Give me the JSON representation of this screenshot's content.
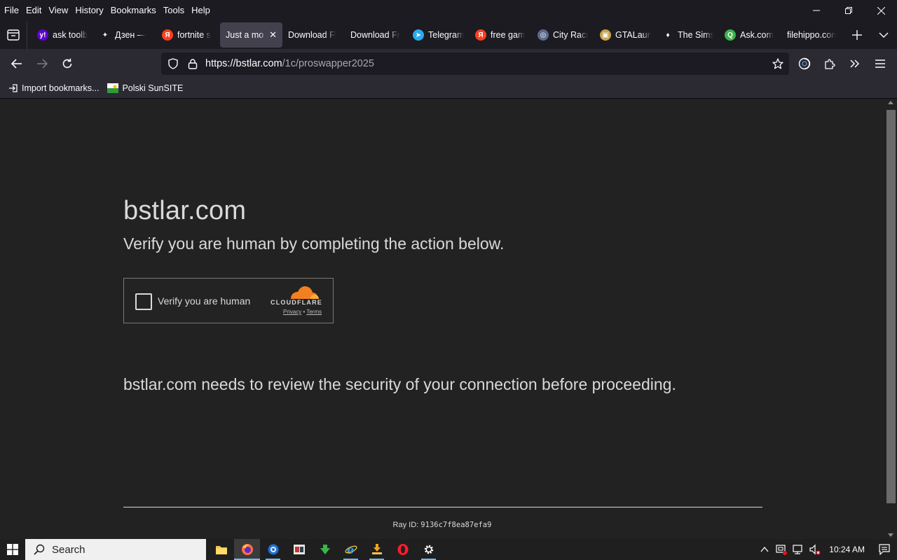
{
  "menu": [
    "File",
    "Edit",
    "View",
    "History",
    "Bookmarks",
    "Tools",
    "Help"
  ],
  "tabs": [
    {
      "label": "ask toolb",
      "icon": "yahoo-icon",
      "color": "#6001d2",
      "glyph": "y!"
    },
    {
      "label": "Дзен —",
      "icon": "dzen-icon",
      "color": "#1c1b22",
      "glyph": "✦"
    },
    {
      "label": "fortnite s",
      "icon": "yandex-icon",
      "color": "#fc3f1d",
      "glyph": "Я"
    },
    {
      "label": "Just a mo",
      "icon": "",
      "color": "",
      "glyph": "",
      "active": true
    },
    {
      "label": "Download Fi",
      "icon": "",
      "color": "",
      "glyph": ""
    },
    {
      "label": "Download Fr",
      "icon": "",
      "color": "",
      "glyph": ""
    },
    {
      "label": "Telegram",
      "icon": "telegram-icon",
      "color": "#2aabee",
      "glyph": "➤"
    },
    {
      "label": "free gam",
      "icon": "yandex-icon",
      "color": "#fc3f1d",
      "glyph": "Я"
    },
    {
      "label": "City Raci",
      "icon": "game-icon",
      "color": "#5a6a8a",
      "glyph": "◎"
    },
    {
      "label": "GTALaun",
      "icon": "gta-icon",
      "color": "#c9a24b",
      "glyph": "▣"
    },
    {
      "label": "The Sims",
      "icon": "plumbob-icon",
      "color": "#1c1b22",
      "glyph": "♦"
    },
    {
      "label": "Ask.com",
      "icon": "ask-icon",
      "color": "#3db34a",
      "glyph": "Q"
    },
    {
      "label": "filehippo.con",
      "icon": "",
      "color": "",
      "glyph": ""
    }
  ],
  "url": {
    "host": "https://bstlar.com",
    "path": "/1c/proswapper2025"
  },
  "bookmarks": [
    {
      "label": "Import bookmarks...",
      "icon": "import-icon"
    },
    {
      "label": "Polski SunSITE",
      "icon": "sunsite-icon"
    }
  ],
  "page": {
    "title": "bstlar.com",
    "subtitle": "Verify you are human by completing the action below.",
    "checkbox_label": "Verify you are human",
    "cf_word": "CLOUDFLARE",
    "privacy": "Privacy",
    "separator": "•",
    "terms": "Terms",
    "review": "bstlar.com needs to review the security of your connection before proceeding.",
    "ray_label": "Ray ID:",
    "ray_value": "9136c7f8ea87efa9"
  },
  "taskbar": {
    "search_placeholder": "Search",
    "clock": "10:24 AM"
  },
  "colors": {
    "accent": "#f38020",
    "page_bg": "#222222",
    "toolbar_bg": "#2b2a33"
  }
}
